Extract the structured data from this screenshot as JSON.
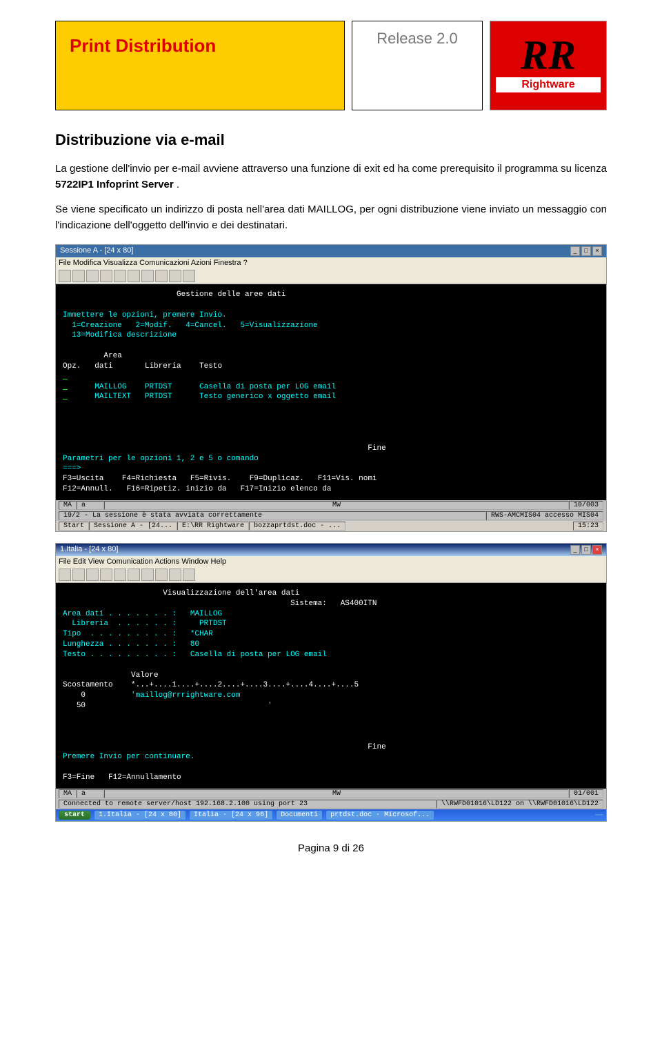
{
  "header": {
    "brand_title": "Print Distribution",
    "release": "Release 2.0",
    "logo_brand": "Rightware"
  },
  "section": {
    "title": "Distribuzione via e-mail",
    "para1_a": "La gestione dell'invio per e-mail avviene attraverso una funzione di exit ed ha come prerequisito il programma su licenza ",
    "para1_b": "5722IP1  Infoprint Server",
    "para1_c": ".",
    "para2": "Se viene specificato un indirizzo di posta nell'area dati MAILLOG, per ogni distribuzione viene inviato un messaggio con l'indicazione dell'oggetto dell'invio e dei destinatari."
  },
  "footer": {
    "page_label": "Pagina 9 di 26"
  },
  "win1": {
    "title": "Sessione A - [24 x 80]",
    "menu": "File  Modifica  Visualizza  Comunicazioni  Azioni  Finestra  ?",
    "screen_title": "Gestione delle aree dati",
    "intro": "Immettere le opzioni, premere Invio.",
    "ops1": "  1=Creazione   2=Modif.   4=Cancel.   5=Visualizzazione",
    "ops2": "  13=Modifica descrizione",
    "hdr_area": "Area",
    "hdr_opz": "Opz.",
    "hdr_dati": "dati",
    "hdr_lib": "Libreria",
    "hdr_testo": "Testo",
    "row1_name": "MAILLOG",
    "row1_lib": "PRTDST",
    "row1_txt": "Casella di posta per LOG email",
    "row2_name": "MAILTEXT",
    "row2_lib": "PRTDST",
    "row2_txt": "Testo generico x oggetto email",
    "fine": "Fine",
    "param": "Parametri per le opzioni 1, 2 e 5 o comando",
    "arrow": "===>",
    "f1": "F3=Uscita",
    "f2": "F4=Richiesta",
    "f3": "F5=Rivis.",
    "f4": "F9=Duplicaz.",
    "f5": "F11=Vis. nomi",
    "f6": "F12=Annull.",
    "f7": "F16=Ripetiz. inizio da",
    "f8": "F17=Inizio elenco da",
    "stat_ma": "MA",
    "stat_a": "a",
    "stat_mw": "MW",
    "stat_pos": "10/003",
    "sb1": "19/2 - La sessione è stata avviata correttamente",
    "sb2": "RWS-AMCMIS04 accesso MIS04",
    "task_start": "Start",
    "task1": "Sessione A - [24...",
    "task2": "E:\\RR Rightware",
    "task3": "bozzaprtdst.doc - ...",
    "tray": "15:23"
  },
  "win2": {
    "title": "1.Italia - [24 x 80]",
    "menu": "File  Edit  View  Comunication  Actions  Window  Help",
    "screen_title": "Visualizzazione dell'area dati",
    "sys_lbl": "Sistema:",
    "sys_val": "AS400ITN",
    "f_area_lbl": "Area dati . . . . . . . :",
    "f_area_val": "MAILLOG",
    "f_lib_lbl": "  Libreria  . . . . . . :",
    "f_lib_val": "  PRTDST",
    "f_tipo_lbl": "Tipo  . . . . . . . . . :",
    "f_tipo_val": "*CHAR",
    "f_len_lbl": "Lunghezza . . . . . . . :",
    "f_len_val": "80",
    "f_text_lbl": "Testo . . . . . . . . . :",
    "f_text_val": "Casella di posta per LOG email",
    "val_hdr": "Valore",
    "scost": "Scostamento",
    "ruler": "*...+....1....+....2....+....3....+....4....+....5",
    "off0": "0",
    "off50": "50",
    "val0": "'maillog@rrrightware.com",
    "val50": "'",
    "fine": "Fine",
    "prompt": "Premere Invio per continuare.",
    "f1": "F3=Fine",
    "f2": "F12=Annullamento",
    "stat_ma": "MA",
    "stat_a": "a",
    "stat_mw": "MW",
    "stat_pos": "01/001",
    "sb1": "Connected to remote server/host 192.168.2.100 using port 23",
    "sb2": "\\\\RWFD01016\\LD122 on \\\\RWFD01016\\LD122",
    "task_start": "start",
    "task1": "1.Italia - [24 x 80]",
    "task2": "Italia - [24 x 96]",
    "task3": "Documenti",
    "task4": "prtdst.doc - Microsof...",
    "tray": ""
  }
}
